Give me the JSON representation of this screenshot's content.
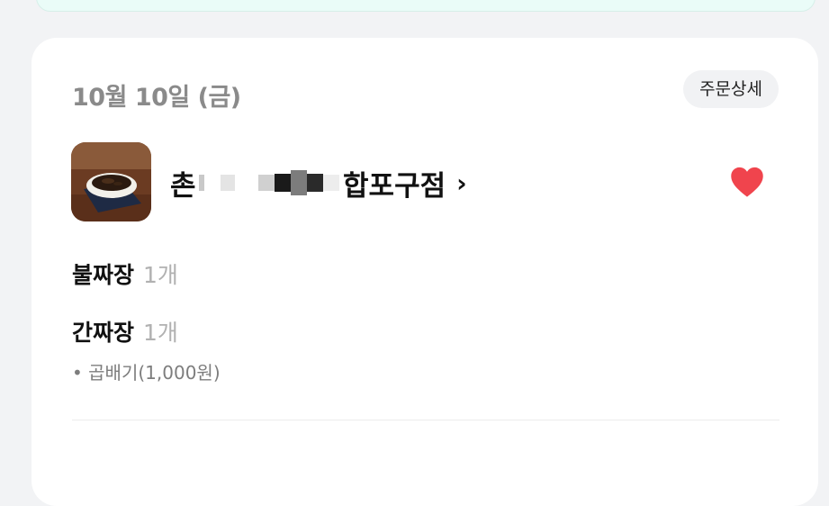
{
  "order": {
    "date": "10월 10일 (금)",
    "detail_button": "주문상세",
    "store": {
      "name_start": "촌",
      "name_end": "합포구점",
      "chevron": "›"
    },
    "items": [
      {
        "name": "불짜장",
        "qty": "1개"
      },
      {
        "name": "간짜장",
        "qty": "1개"
      }
    ],
    "option": "• 곱배기(1,000원)",
    "favorite": true
  },
  "colors": {
    "background": "#f2f3f5",
    "card": "#ffffff",
    "heart": "#f0444d",
    "muted_text": "#8a8a8a"
  }
}
